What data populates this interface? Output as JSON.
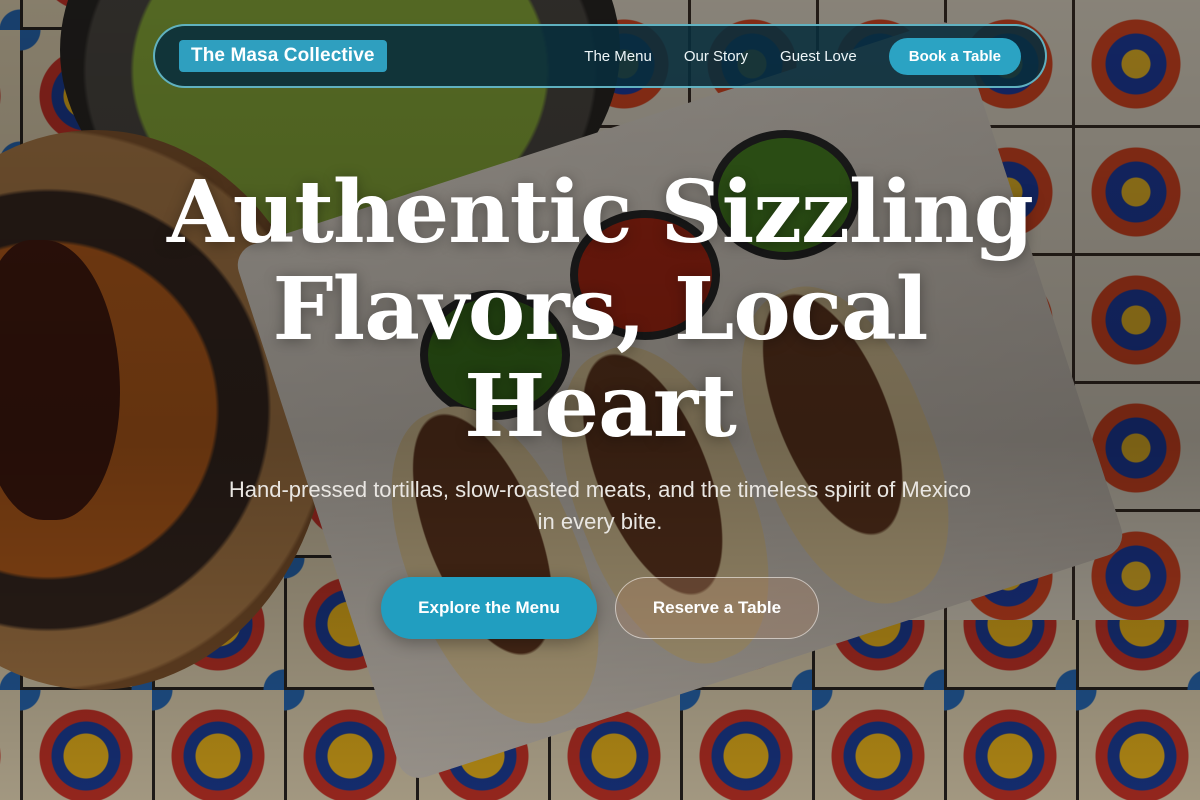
{
  "colors": {
    "accent": "#2ba3c3",
    "nav_background": "#082d3c",
    "nav_border": "#6ec8d7"
  },
  "nav": {
    "brand": "The Masa Collective",
    "links": [
      "The Menu",
      "Our Story",
      "Guest Love"
    ],
    "cta": "Book a Table"
  },
  "hero": {
    "title_lines": [
      "Authentic Sizzling",
      "Flavors, Local",
      "Heart"
    ],
    "subtitle_lines": [
      "Hand-pressed tortillas, slow-roasted meats, and the timeless spirit of Mexico",
      "in every bite."
    ],
    "primary_cta": "Explore the Menu",
    "secondary_cta": "Reserve a Table"
  }
}
